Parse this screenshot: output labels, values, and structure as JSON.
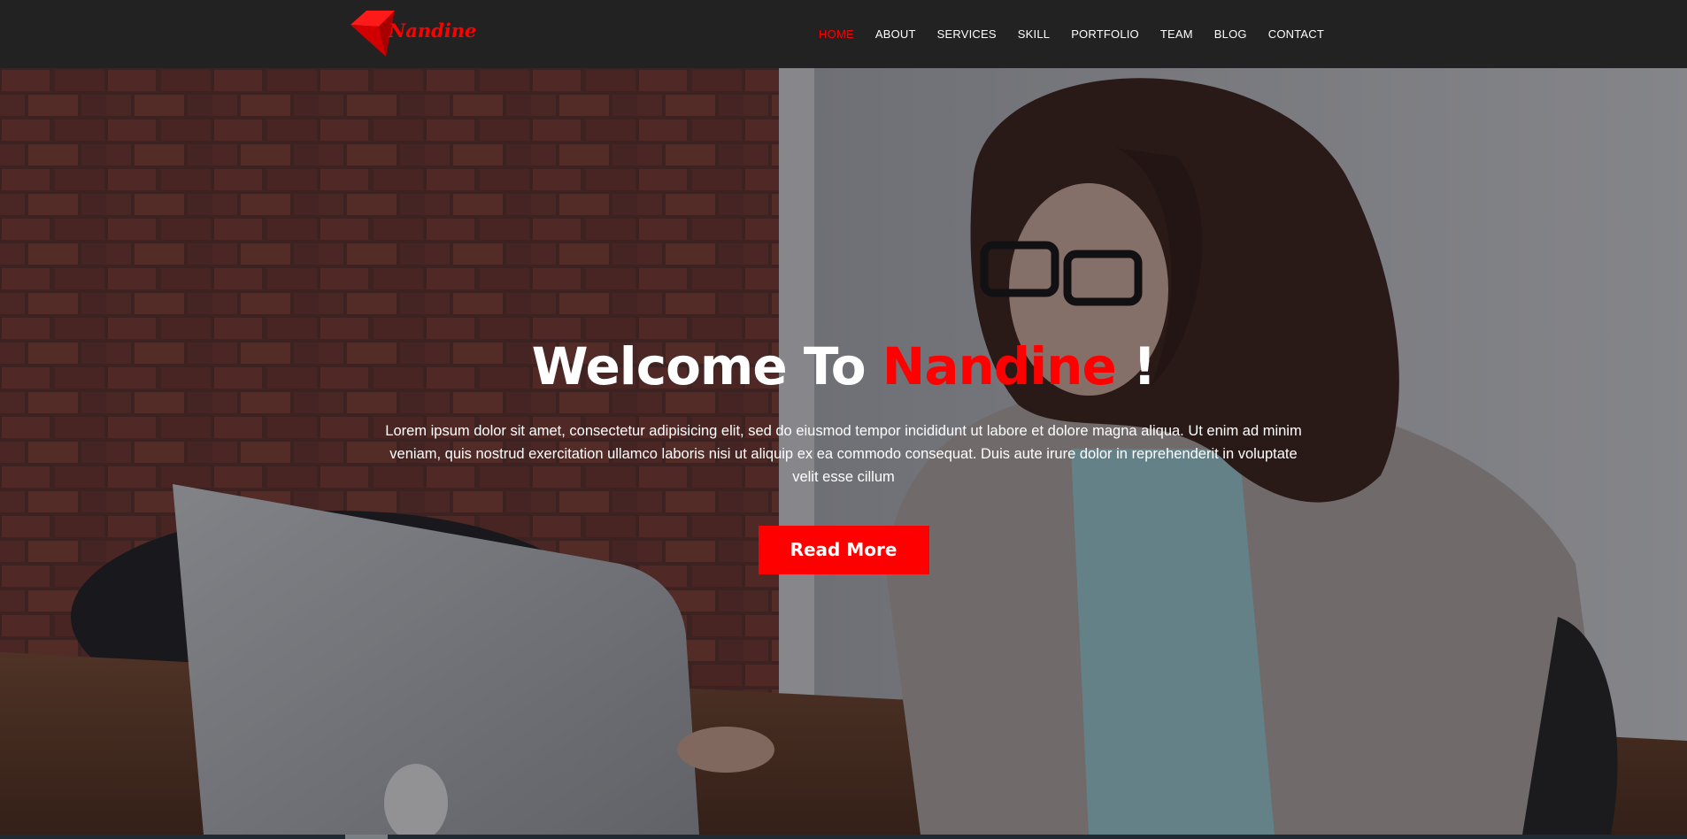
{
  "brand": {
    "name": "Nandine",
    "logo_icon": "red-folded-diamond-logo",
    "accent_color": "#ff0000"
  },
  "nav": {
    "items": [
      {
        "label": "HOME",
        "active": true
      },
      {
        "label": "ABOUT",
        "active": false
      },
      {
        "label": "SERVICES",
        "active": false
      },
      {
        "label": "SKILL",
        "active": false
      },
      {
        "label": "PORTFOLIO",
        "active": false
      },
      {
        "label": "TEAM",
        "active": false
      },
      {
        "label": "BLOG",
        "active": false
      },
      {
        "label": "CONTACT",
        "active": false
      }
    ],
    "background": "#222222"
  },
  "hero": {
    "title_prefix": "Welcome To ",
    "title_highlight": "Nandine",
    "title_suffix": " !",
    "text": "Lorem ipsum dolor sit amet, consectetur adipisicing elit, sed do eiusmod tempor incididunt ut labore et dolore magna aliqua. Ut enim ad minim veniam, quis nostrud exercitation ullamco laboris nisi ut aliquip ex ea commodo consequat. Duis aute irure dolor in reprehenderit in voluptate velit esse cillum",
    "button_label": "Read More",
    "background_image": "woman-with-glasses-working-on-laptop-photo"
  }
}
